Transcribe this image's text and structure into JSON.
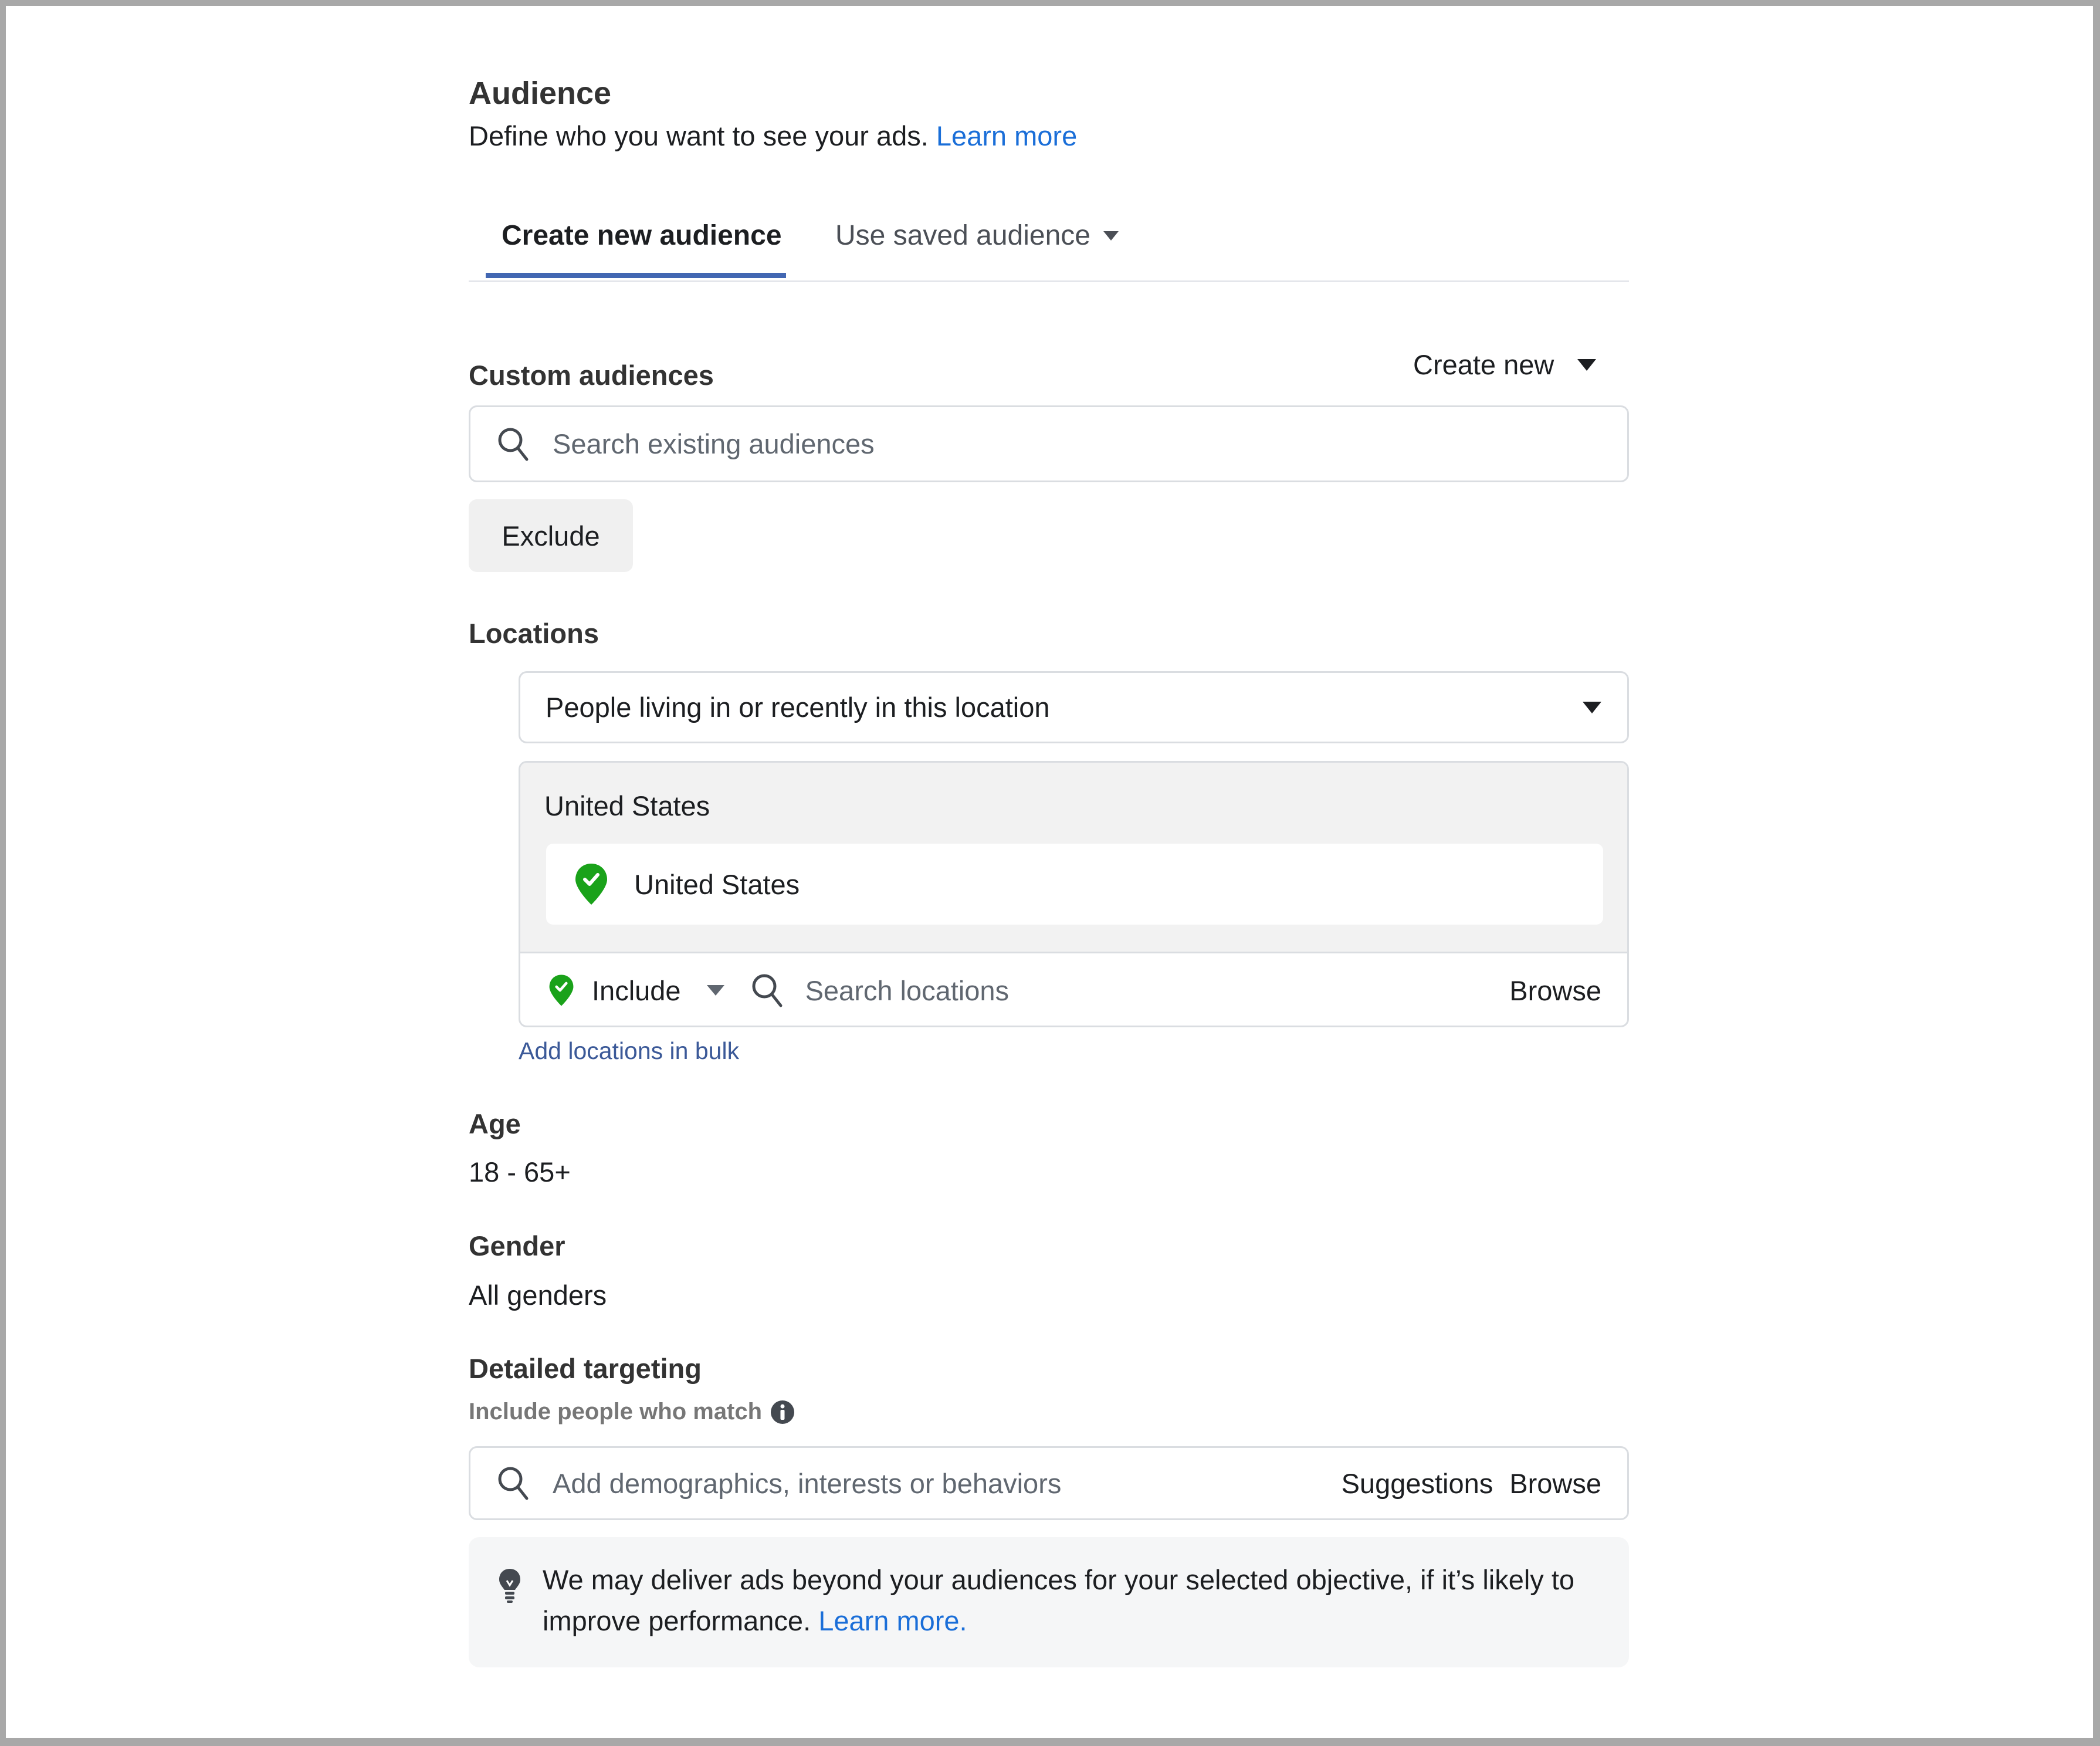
{
  "header": {
    "title": "Audience",
    "description": "Define who you want to see your ads.",
    "learn_more": "Learn more"
  },
  "tabs": [
    {
      "label": "Create new audience",
      "active": true
    },
    {
      "label": "Use saved audience",
      "active": false
    }
  ],
  "custom_audiences": {
    "label": "Custom audiences",
    "create_new": "Create new",
    "search_placeholder": "Search existing audiences",
    "exclude_label": "Exclude"
  },
  "locations": {
    "label": "Locations",
    "type_select": "People living in or recently in this location",
    "group_title": "United States",
    "items": [
      {
        "name": "United States",
        "status": "included"
      }
    ],
    "include_label": "Include",
    "search_placeholder": "Search locations",
    "browse_label": "Browse",
    "bulk_link": "Add locations in bulk"
  },
  "age": {
    "label": "Age",
    "value": "18 - 65+"
  },
  "gender": {
    "label": "Gender",
    "value": "All genders"
  },
  "detailed_targeting": {
    "label": "Detailed targeting",
    "sublabel": "Include people who match",
    "search_placeholder": "Add demographics, interests or behaviors",
    "suggestions_label": "Suggestions",
    "browse_label": "Browse"
  },
  "notice": {
    "text": "We may deliver ads beyond your audiences for your selected objective, if it’s likely to improve performance.",
    "learn_more": "Learn more."
  },
  "colors": {
    "accent": "#4267b2",
    "link": "#1a6ed8",
    "include_green": "#1aa21a"
  }
}
